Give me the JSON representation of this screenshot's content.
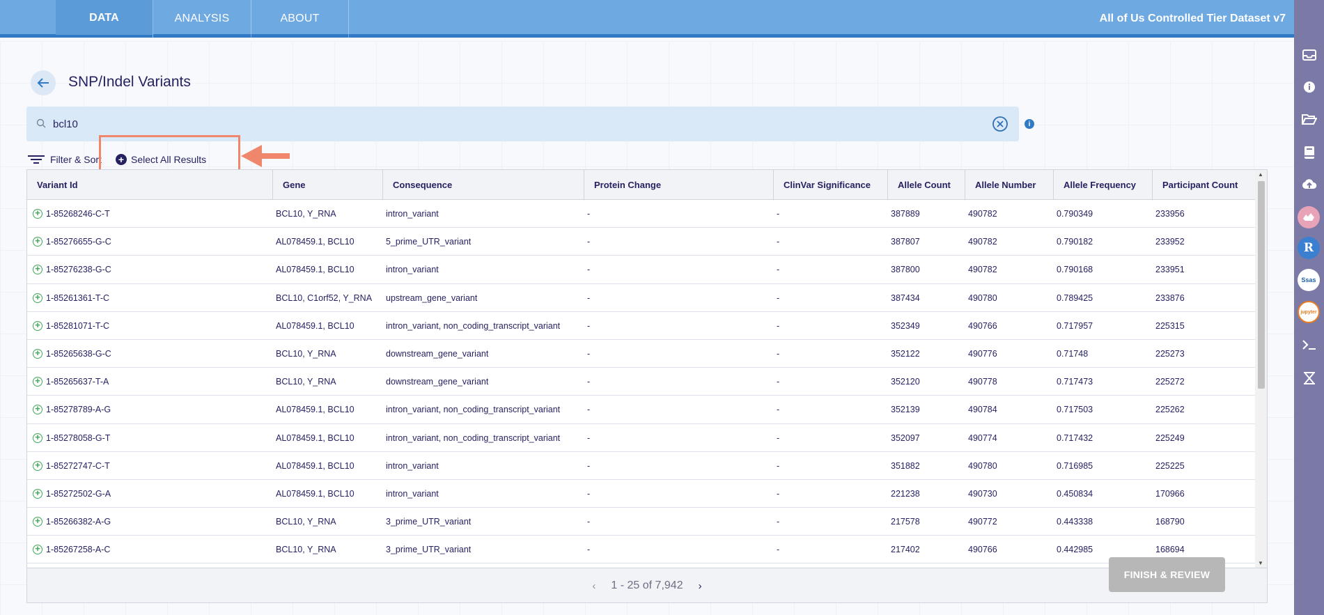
{
  "nav": {
    "tabs": [
      {
        "label": "DATA"
      },
      {
        "label": "ANALYSIS"
      },
      {
        "label": "ABOUT"
      }
    ],
    "workspace_title": "All of Us Controlled Tier Dataset v7"
  },
  "page": {
    "title": "SNP/Indel Variants"
  },
  "search": {
    "value": "bcl10",
    "placeholder": ""
  },
  "toolbar": {
    "filter_sort_label": "Filter & Sort",
    "select_all_label": "Select All Results"
  },
  "table": {
    "headers": [
      "Variant Id",
      "Gene",
      "Consequence",
      "Protein Change",
      "ClinVar Significance",
      "Allele Count",
      "Allele Number",
      "Allele Frequency",
      "Participant Count"
    ],
    "rows": [
      {
        "id": "1-85268246-C-T",
        "gene": "BCL10, Y_RNA",
        "consequence": "intron_variant",
        "protein": "-",
        "clinvar": "-",
        "allele_count": "387889",
        "allele_number": "490782",
        "allele_freq": "0.790349",
        "participants": "233956"
      },
      {
        "id": "1-85276655-G-C",
        "gene": "AL078459.1, BCL10",
        "consequence": "5_prime_UTR_variant",
        "protein": "-",
        "clinvar": "-",
        "allele_count": "387807",
        "allele_number": "490782",
        "allele_freq": "0.790182",
        "participants": "233952"
      },
      {
        "id": "1-85276238-G-C",
        "gene": "AL078459.1, BCL10",
        "consequence": "intron_variant",
        "protein": "-",
        "clinvar": "-",
        "allele_count": "387800",
        "allele_number": "490782",
        "allele_freq": "0.790168",
        "participants": "233951"
      },
      {
        "id": "1-85261361-T-C",
        "gene": "BCL10, C1orf52, Y_RNA",
        "consequence": "upstream_gene_variant",
        "protein": "-",
        "clinvar": "-",
        "allele_count": "387434",
        "allele_number": "490780",
        "allele_freq": "0.789425",
        "participants": "233876"
      },
      {
        "id": "1-85281071-T-C",
        "gene": "AL078459.1, BCL10",
        "consequence": "intron_variant, non_coding_transcript_variant",
        "protein": "-",
        "clinvar": "-",
        "allele_count": "352349",
        "allele_number": "490766",
        "allele_freq": "0.717957",
        "participants": "225315"
      },
      {
        "id": "1-85265638-G-C",
        "gene": "BCL10, Y_RNA",
        "consequence": "downstream_gene_variant",
        "protein": "-",
        "clinvar": "-",
        "allele_count": "352122",
        "allele_number": "490776",
        "allele_freq": "0.71748",
        "participants": "225273"
      },
      {
        "id": "1-85265637-T-A",
        "gene": "BCL10, Y_RNA",
        "consequence": "downstream_gene_variant",
        "protein": "-",
        "clinvar": "-",
        "allele_count": "352120",
        "allele_number": "490778",
        "allele_freq": "0.717473",
        "participants": "225272"
      },
      {
        "id": "1-85278789-A-G",
        "gene": "AL078459.1, BCL10",
        "consequence": "intron_variant, non_coding_transcript_variant",
        "protein": "-",
        "clinvar": "-",
        "allele_count": "352139",
        "allele_number": "490784",
        "allele_freq": "0.717503",
        "participants": "225262"
      },
      {
        "id": "1-85278058-G-T",
        "gene": "AL078459.1, BCL10",
        "consequence": "intron_variant, non_coding_transcript_variant",
        "protein": "-",
        "clinvar": "-",
        "allele_count": "352097",
        "allele_number": "490774",
        "allele_freq": "0.717432",
        "participants": "225249"
      },
      {
        "id": "1-85272747-C-T",
        "gene": "AL078459.1, BCL10",
        "consequence": "intron_variant",
        "protein": "-",
        "clinvar": "-",
        "allele_count": "351882",
        "allele_number": "490780",
        "allele_freq": "0.716985",
        "participants": "225225"
      },
      {
        "id": "1-85272502-G-A",
        "gene": "AL078459.1, BCL10",
        "consequence": "intron_variant",
        "protein": "-",
        "clinvar": "-",
        "allele_count": "221238",
        "allele_number": "490730",
        "allele_freq": "0.450834",
        "participants": "170966"
      },
      {
        "id": "1-85266382-A-G",
        "gene": "BCL10, Y_RNA",
        "consequence": "3_prime_UTR_variant",
        "protein": "-",
        "clinvar": "-",
        "allele_count": "217578",
        "allele_number": "490772",
        "allele_freq": "0.443338",
        "participants": "168790"
      },
      {
        "id": "1-85267258-A-C",
        "gene": "BCL10, Y_RNA",
        "consequence": "3_prime_UTR_variant",
        "protein": "-",
        "clinvar": "-",
        "allele_count": "217402",
        "allele_number": "490766",
        "allele_freq": "0.442985",
        "participants": "168694"
      }
    ],
    "pagination": "1 - 25 of 7,942"
  },
  "finish_button": "FINISH & REVIEW",
  "sidebar_icons": [
    "inbox-icon",
    "info-icon",
    "folder-open-icon",
    "book-icon",
    "cloud-upload-icon",
    "rstudio-icon",
    "r-icon",
    "sas-icon",
    "jupyter-icon",
    "terminal-icon",
    "hourglass-icon"
  ],
  "sidebar_text": {
    "r": "R",
    "sas": "Ssas",
    "jupyter": "jupyter"
  },
  "colors": {
    "nav": "#6ea9e1",
    "nav_border": "#2f79c5",
    "sidebar": "#7b7aa6",
    "highlight": "#f0876d",
    "add_green": "#3ea856"
  }
}
